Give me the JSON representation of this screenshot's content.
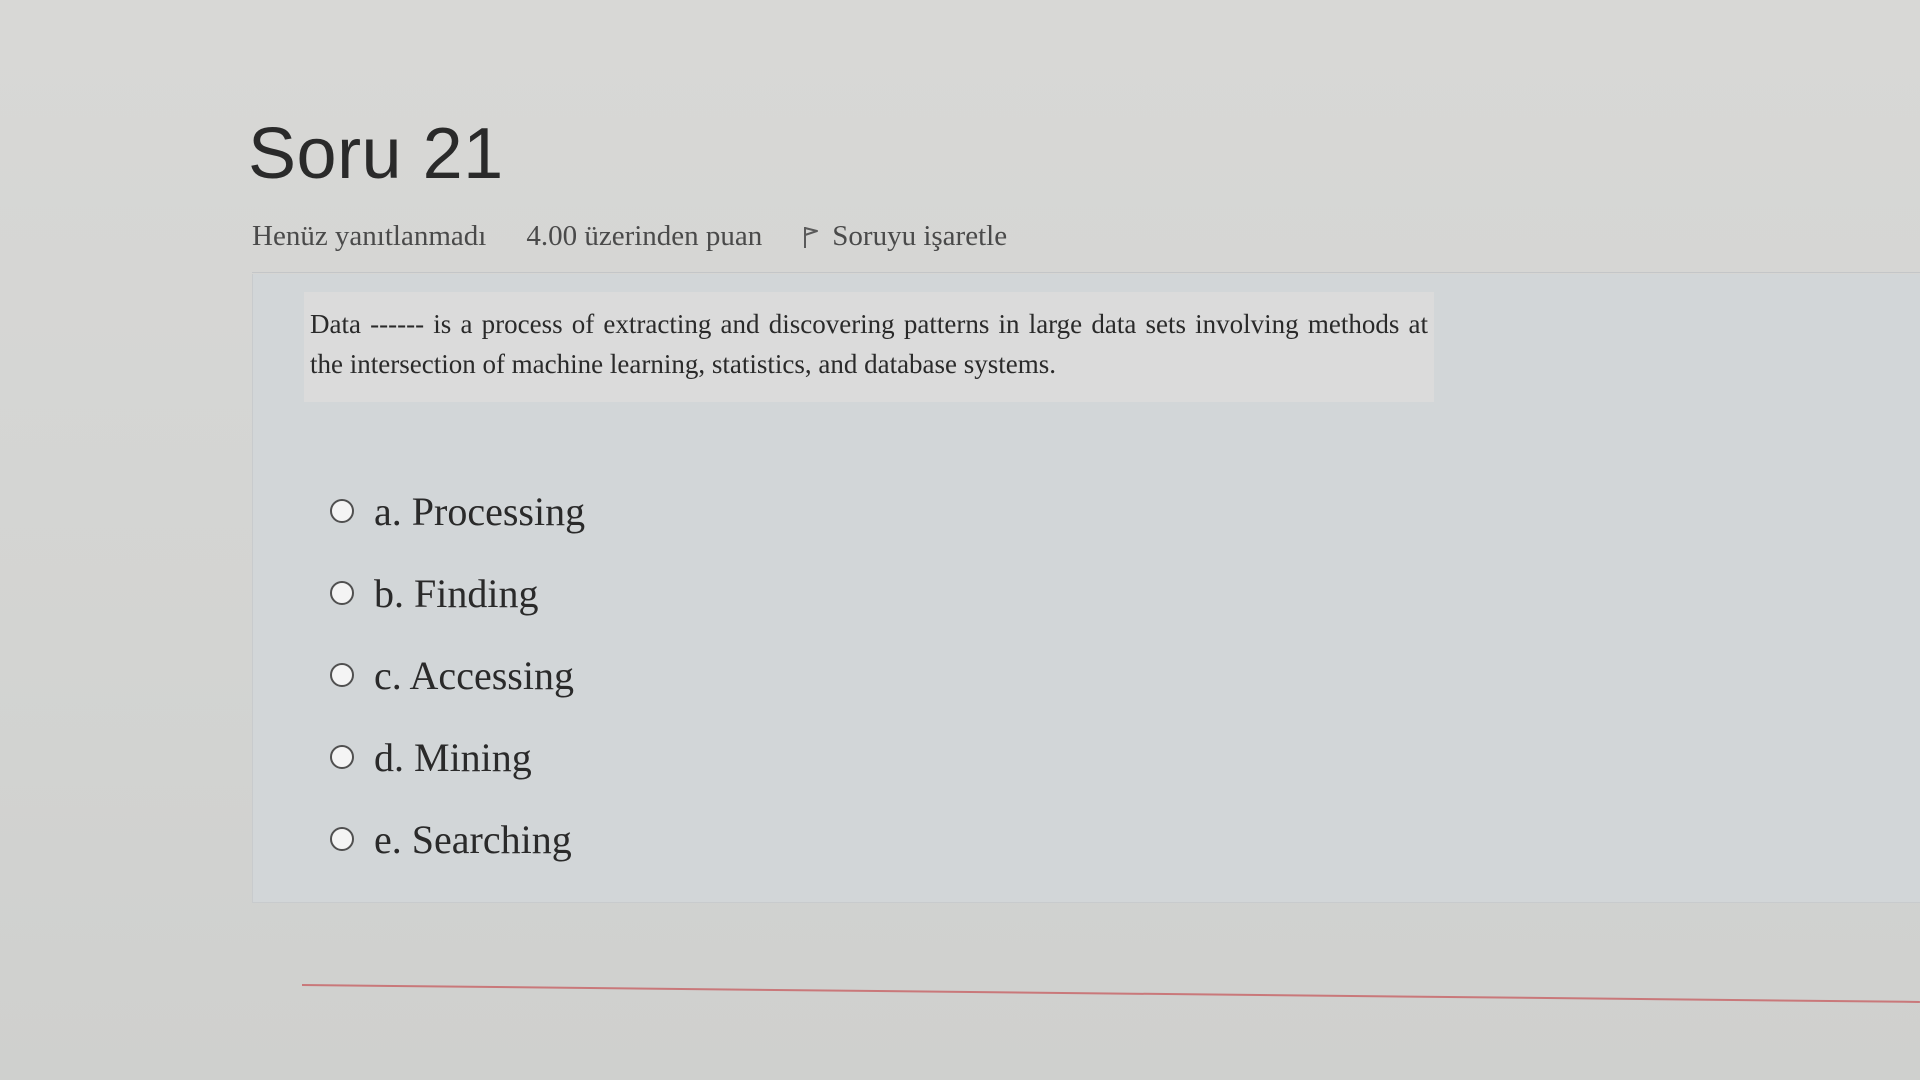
{
  "question": {
    "title": "Soru 21",
    "status": "Henüz yanıtlanmadı",
    "points": "4.00 üzerinden puan",
    "flag_label": "Soruyu işaretle",
    "text": "Data ------ is a process of extracting and discovering patterns in large data sets involving methods at the intersection of machine learning, statistics, and database systems."
  },
  "answers": [
    {
      "label": "a. Processing"
    },
    {
      "label": "b. Finding"
    },
    {
      "label": "c. Accessing"
    },
    {
      "label": "d. Mining"
    },
    {
      "label": "e. Searching"
    }
  ],
  "icons": {
    "flag": "flag-icon"
  },
  "colors": {
    "background": "#d7d7d5",
    "panel": "#d2d6d8",
    "text": "#2a2a2a",
    "bottom_rule": "#c9787a"
  }
}
